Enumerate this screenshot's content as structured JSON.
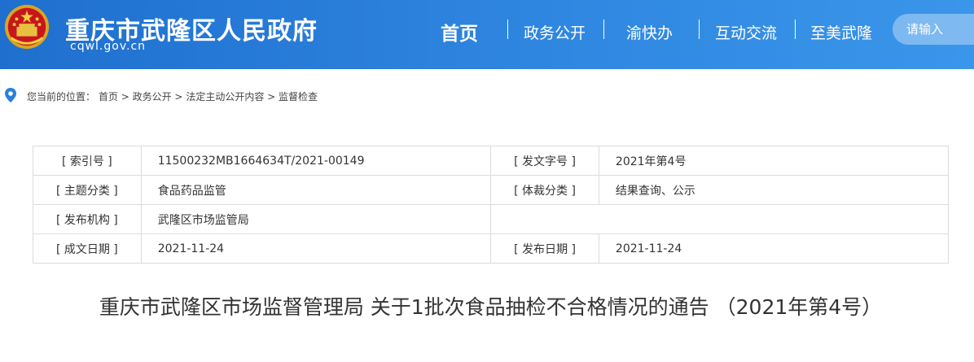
{
  "header": {
    "site_title": "重庆市武隆区人民政府",
    "site_domain": "cqwl.gov.cn",
    "emblem_icon": "national-emblem-icon",
    "colors": {
      "header_bg": "#2a80dc",
      "header_text": "#ffffff"
    }
  },
  "nav": {
    "items": [
      {
        "label": "首页"
      },
      {
        "label": "政务公开"
      },
      {
        "label": "渝快办"
      },
      {
        "label": "互动交流"
      },
      {
        "label": "至美武隆"
      }
    ],
    "search_placeholder": "请输入"
  },
  "breadcrumb": {
    "icon": "location-pin-icon",
    "prefix": "您当前的位置：",
    "items": [
      "首页",
      "政务公开",
      "法定主动公开内容",
      "监督检查"
    ],
    "separator": ">"
  },
  "info": {
    "index_label": "[ 索引号 ]",
    "index_value": "11500232MB1664634T/2021-00149",
    "doc_no_label": "[ 发文字号 ]",
    "doc_no_value": "2021年第4号",
    "topic_label": "[ 主题分类 ]",
    "topic_value": "食品药品监管",
    "genre_label": "[ 体裁分类 ]",
    "genre_value": "结果查询、公示",
    "org_label": "[ 发布机构 ]",
    "org_value": "武隆区市场监管局",
    "created_label": "[ 成文日期 ]",
    "created_value": "2021-11-24",
    "published_label": "[ 发布日期 ]",
    "published_value": "2021-11-24"
  },
  "article": {
    "title": "重庆市武隆区市场监督管理局 关于1批次食品抽检不合格情况的通告 （2021年第4号）"
  }
}
